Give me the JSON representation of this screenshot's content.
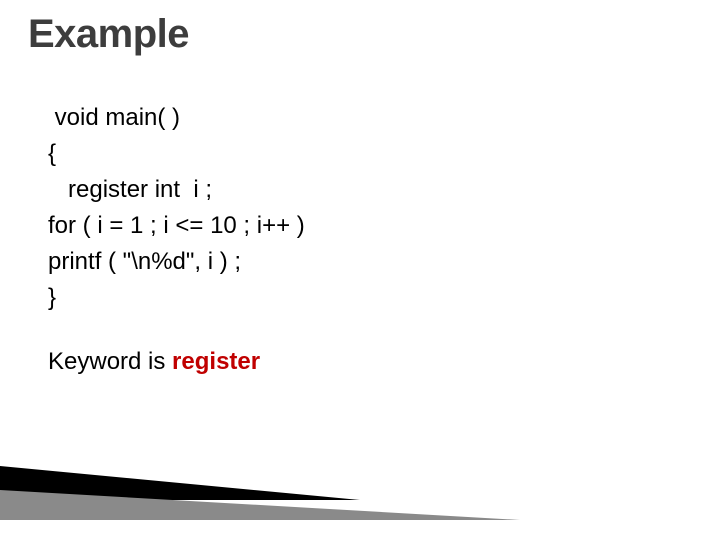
{
  "title": "Example",
  "code": {
    "l1": " void main( )",
    "l2": "{",
    "l3": "   register int  i ;",
    "l4": "for ( i = 1 ; i <= 10 ; i++ )",
    "l5": "printf ( \"\\n%d\", i ) ;",
    "l6": "}"
  },
  "note_prefix": "Keyword is ",
  "note_keyword": "register",
  "colors": {
    "title": "#3d3d3d",
    "keyword": "#c00000",
    "wedge_dark": "#000000",
    "wedge_gray": "#8a8a8a"
  }
}
